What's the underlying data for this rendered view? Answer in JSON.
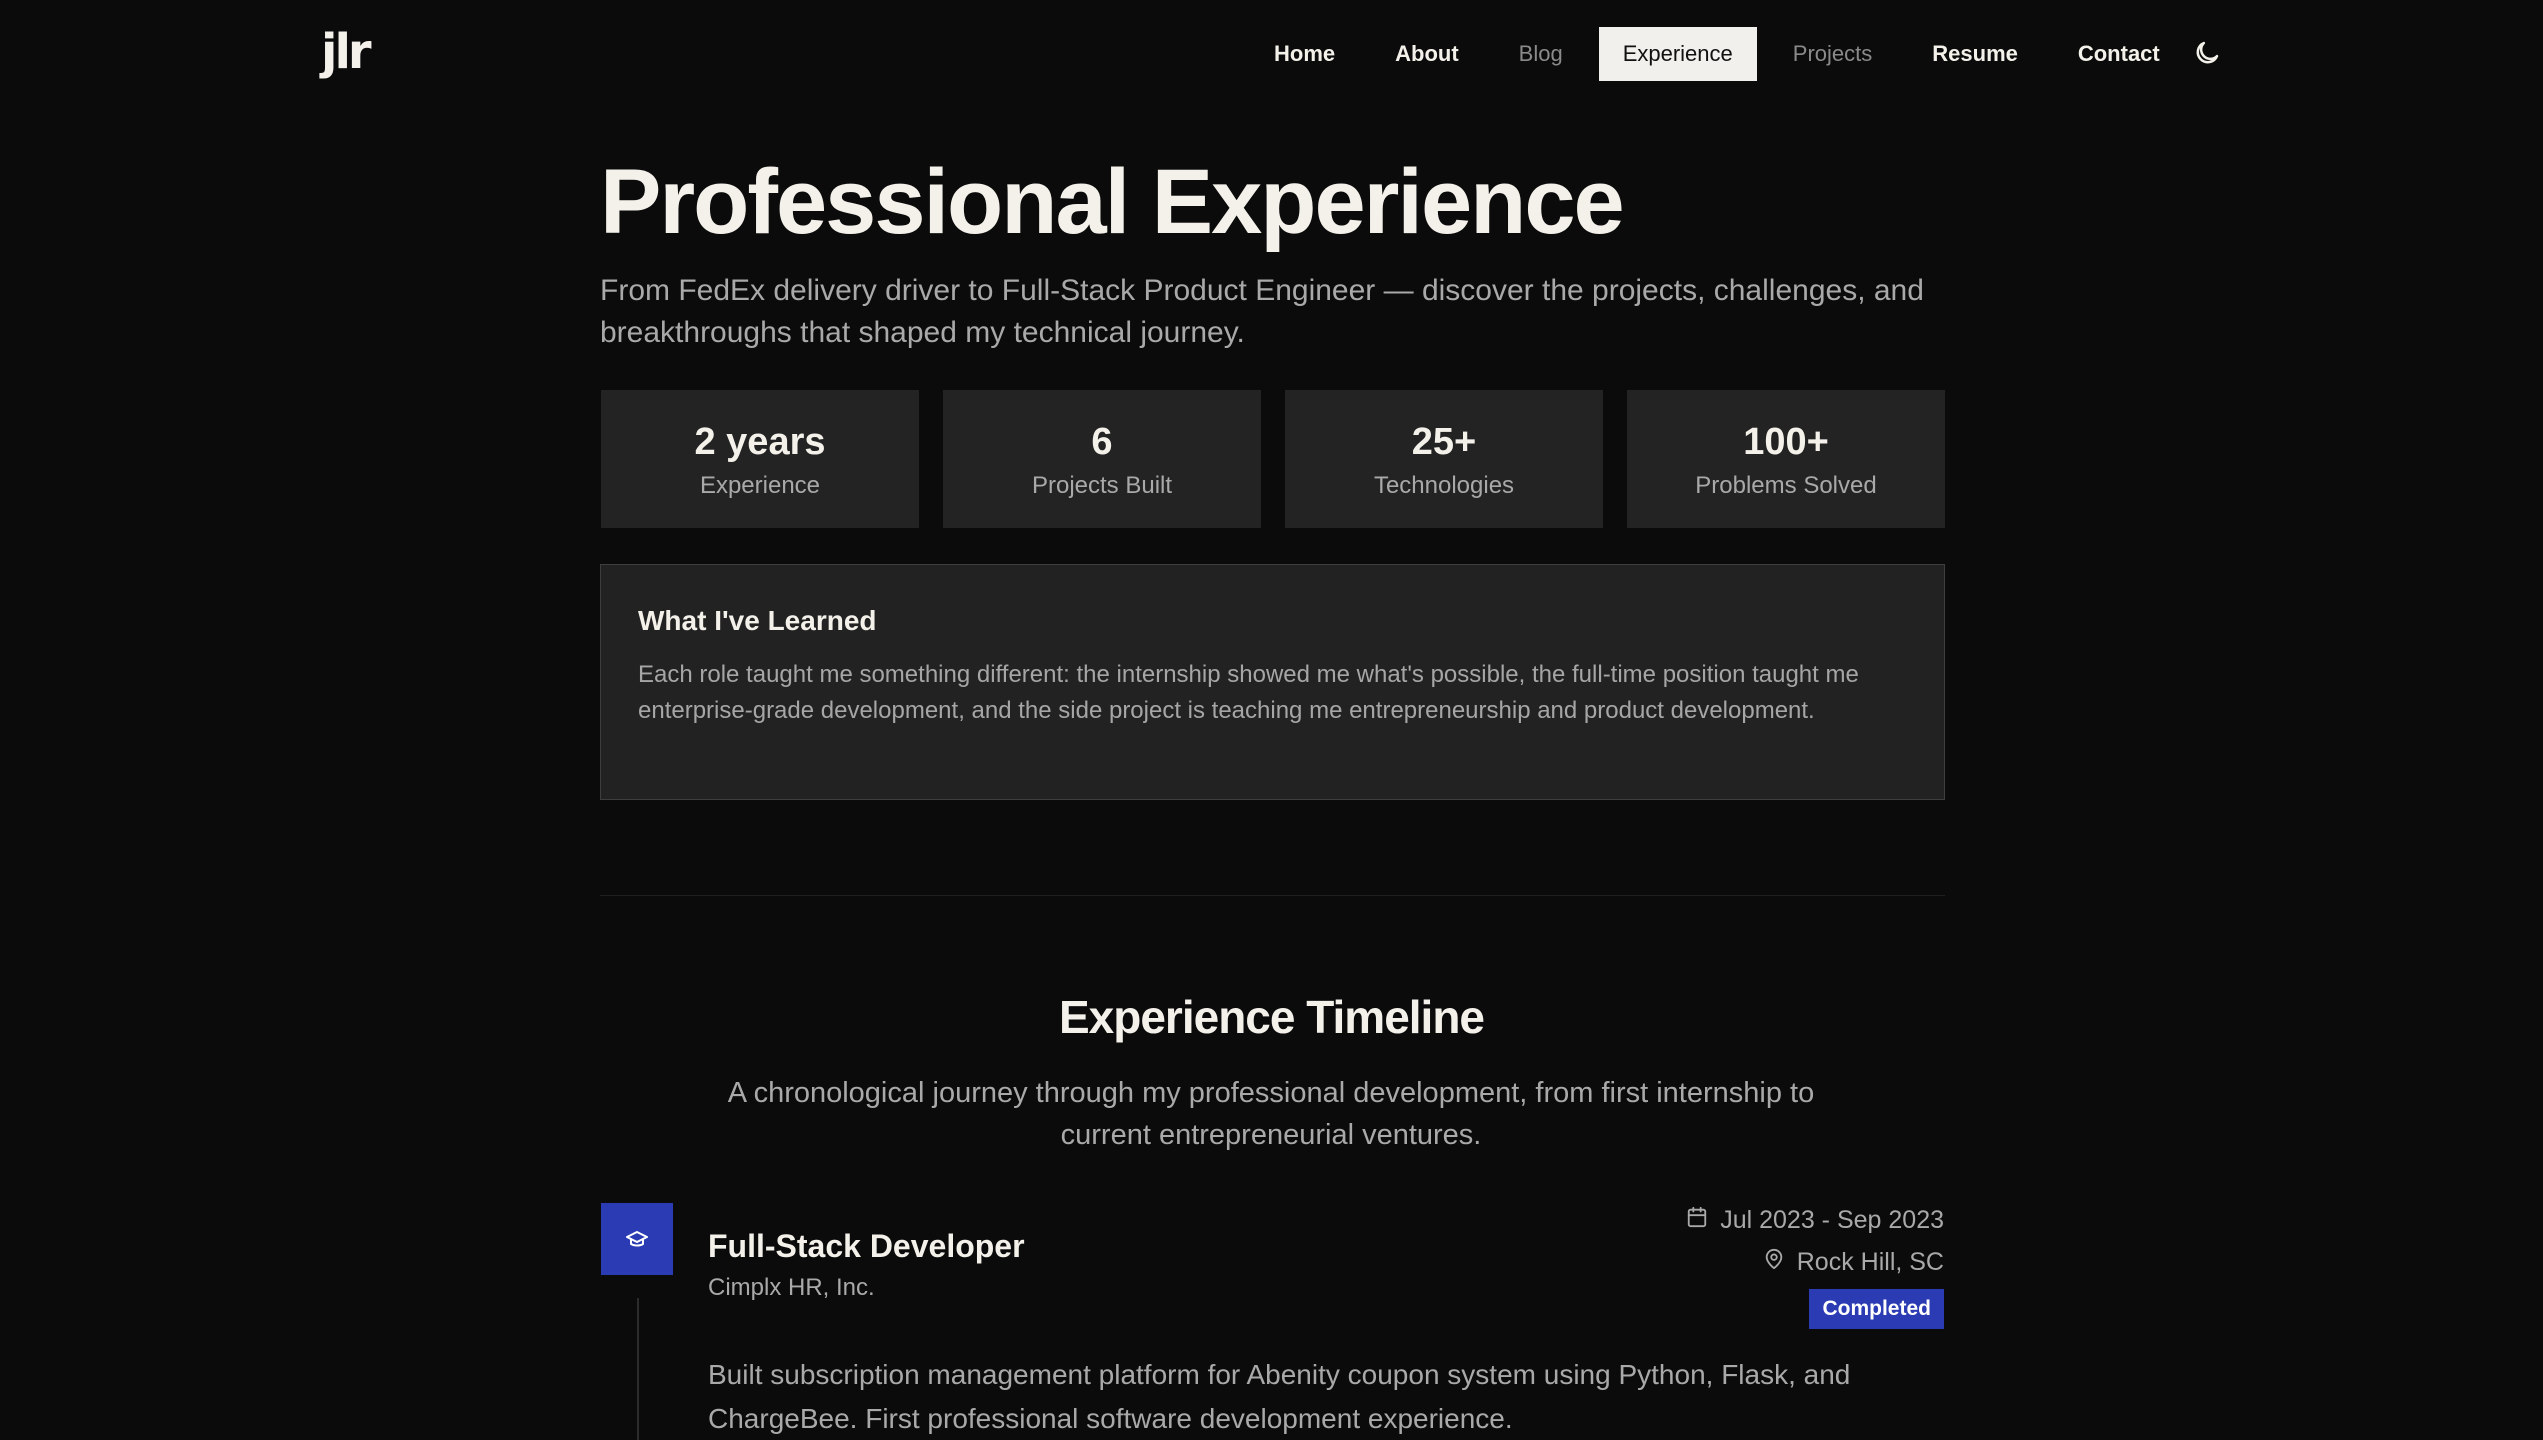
{
  "nav": {
    "logo": "jlr",
    "items": [
      {
        "label": "Home",
        "state": "normal"
      },
      {
        "label": "About",
        "state": "normal"
      },
      {
        "label": "Blog",
        "state": "dim"
      },
      {
        "label": "Experience",
        "state": "active"
      },
      {
        "label": "Projects",
        "state": "dim"
      },
      {
        "label": "Resume",
        "state": "normal"
      },
      {
        "label": "Contact",
        "state": "normal"
      }
    ],
    "theme_toggle_icon": "moon-icon"
  },
  "hero": {
    "title": "Professional Experience",
    "subtitle": "From FedEx delivery driver to Full-Stack Product Engineer — discover the projects, challenges, and breakthroughs that shaped my technical journey."
  },
  "stats": [
    {
      "value": "2 years",
      "label": "Experience"
    },
    {
      "value": "6",
      "label": "Projects Built"
    },
    {
      "value": "25+",
      "label": "Technologies"
    },
    {
      "value": "100+",
      "label": "Problems Solved"
    }
  ],
  "learned": {
    "title": "What I've Learned",
    "body": "Each role taught me something different: the internship showed me what's possible, the full-time position taught me enterprise-grade development, and the side project is teaching me entrepreneurship and product development."
  },
  "timeline": {
    "title": "Experience Timeline",
    "subtitle": "A chronological journey through my professional development, from first internship to current entrepreneurial ventures.",
    "entries": [
      {
        "icon": "graduation-cap-icon",
        "title": "Full-Stack Developer",
        "company": "Cimplx HR, Inc.",
        "dates": "Jul 2023 - Sep 2023",
        "location": "Rock Hill, SC",
        "status": "Completed",
        "description": "Built subscription management platform for Abenity coupon system using Python, Flask, and ChargeBee. First professional software development experience."
      }
    ]
  },
  "colors": {
    "background": "#0b0b0c",
    "card": "#232323",
    "accent": "#2a3bb3",
    "text": "#f4f1ea",
    "muted": "#a9a9a9"
  }
}
